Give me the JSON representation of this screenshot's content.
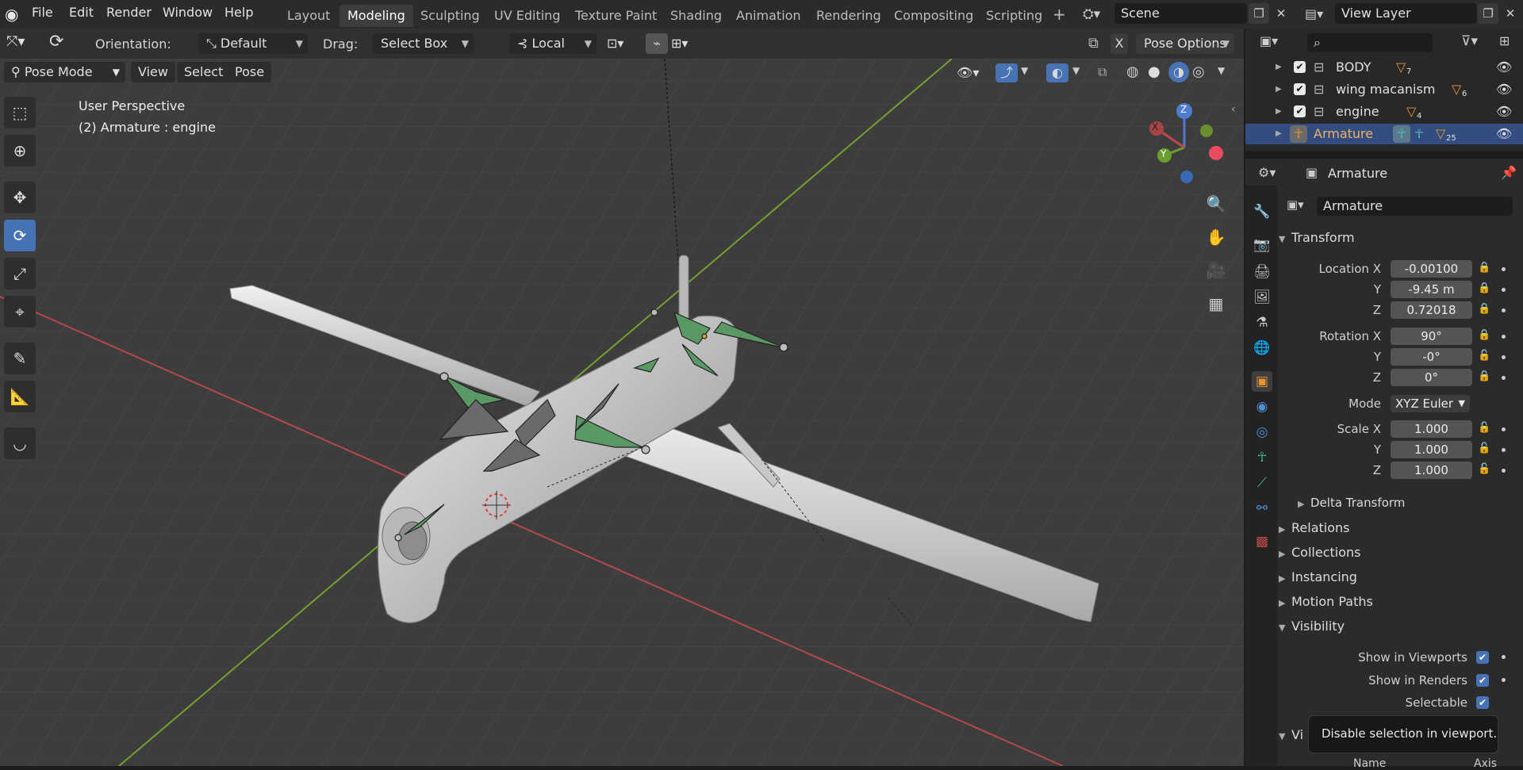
{
  "menu": {
    "file": "File",
    "edit": "Edit",
    "render": "Render",
    "window": "Window",
    "help": "Help"
  },
  "workspaces": [
    "Layout",
    "Modeling",
    "Sculpting",
    "UV Editing",
    "Texture Paint",
    "Shading",
    "Animation",
    "Rendering",
    "Compositing",
    "Scripting"
  ],
  "active_workspace": "Modeling",
  "scene": {
    "name": "Scene"
  },
  "view_layer": {
    "name": "View Layer"
  },
  "toolbar": {
    "orientation_label": "Orientation:",
    "orientation_value": "Default",
    "drag_label": "Drag:",
    "drag_value": "Select Box",
    "pivot_value": "Local",
    "pose_options": "Pose Options"
  },
  "viewport_header": {
    "mode": "Pose Mode",
    "view": "View",
    "select": "Select",
    "pose": "Pose"
  },
  "viewport": {
    "perspective": "User Perspective",
    "object_info": "(2) Armature : engine"
  },
  "gizmo": {
    "x": "X",
    "y": "Y",
    "z": "Z"
  },
  "outliner": {
    "items": [
      {
        "name": "BODY",
        "count": "7"
      },
      {
        "name": "wing macanism",
        "count": "6"
      },
      {
        "name": "engine",
        "count": "4"
      },
      {
        "name": "Armature",
        "count": "25"
      }
    ]
  },
  "properties": {
    "header_object": "Armature",
    "object_name": "Armature",
    "transform": "Transform",
    "location_x_label": "Location X",
    "location_x": "-0.00100",
    "location_y_label": "Y",
    "location_y": "-9.45 m",
    "location_z_label": "Z",
    "location_z": "0.72018",
    "rotation_x_label": "Rotation X",
    "rotation_x": "90°",
    "rotation_y_label": "Y",
    "rotation_y": "-0°",
    "rotation_z_label": "Z",
    "rotation_z": "0°",
    "mode_label": "Mode",
    "mode_value": "XYZ Euler",
    "scale_x_label": "Scale X",
    "scale_x": "1.000",
    "scale_y_label": "Y",
    "scale_y": "1.000",
    "scale_z_label": "Z",
    "scale_z": "1.000",
    "delta_transform": "Delta Transform",
    "relations": "Relations",
    "collections": "Collections",
    "instancing": "Instancing",
    "motion_paths": "Motion Paths",
    "visibility": "Visibility",
    "show_viewports": "Show in Viewports",
    "show_renders": "Show in Renders",
    "selectable": "Selectable",
    "viewport_display_partial": "Vi",
    "name_partial": "Name",
    "axis_partial": "Axis"
  },
  "tooltip": {
    "text": "Disable selection in viewport."
  },
  "colors": {
    "accent": "#4772b3",
    "bone_green": "#5aa36a",
    "axis_red": "#c84b4b",
    "axis_green": "#7aa33a"
  }
}
